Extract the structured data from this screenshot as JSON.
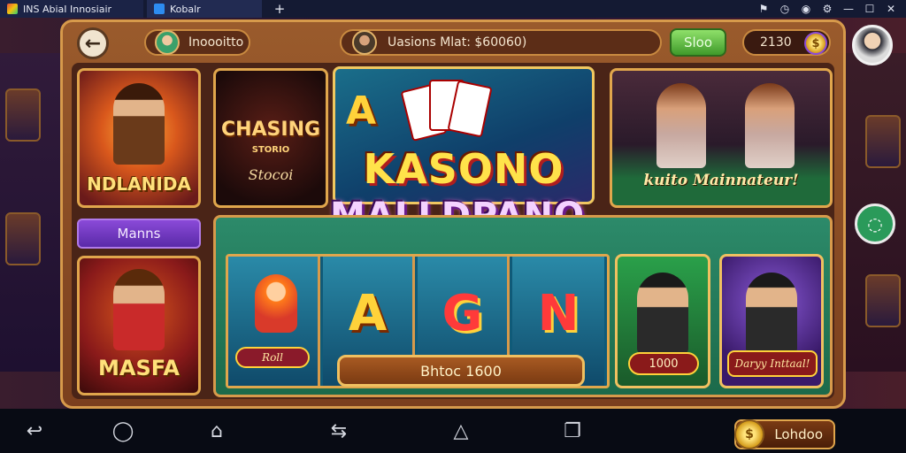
{
  "window": {
    "tabs": [
      {
        "label": "INS AbiaI Innosiair",
        "icon": "app-icon"
      },
      {
        "label": "Kobalr",
        "icon": "app-icon"
      }
    ],
    "new_tab_symbol": "+",
    "controls": [
      "bell-icon",
      "clock-icon",
      "circle-icon",
      "settings-icon",
      "minimize-icon",
      "maximize-icon",
      "close-icon"
    ]
  },
  "header": {
    "back_symbol": "←",
    "profile_name": "Inoooitto",
    "banner_text": "Uasions Mlat: $60060)",
    "store_label": "Sloo",
    "coins": "2130",
    "coin_symbol": "$"
  },
  "tiles": {
    "nd_label": "NDLANIDA",
    "chasing_title": "CHASING",
    "chasing_sub": "STORIO",
    "chasing_script": "Stocoi",
    "kasino_letter": "A",
    "kasino_title": "KASONO",
    "kasino_sub": "MALLDPANO",
    "hostess_label": "kuito Mainnateur!",
    "manns_label": "Manns",
    "masfa_label": "MASFA",
    "roll_label": "Roll",
    "reel_symbols": [
      "A",
      "G",
      "N"
    ],
    "bet_label": "Bhtoc 1600",
    "poker_label": "1000",
    "singer_label": "Daryy Inttaal!"
  },
  "side": {
    "bubble_symbol": "◌"
  },
  "navbar": {
    "lobby_label": "Lohdoo",
    "lobby_coin": "$"
  }
}
